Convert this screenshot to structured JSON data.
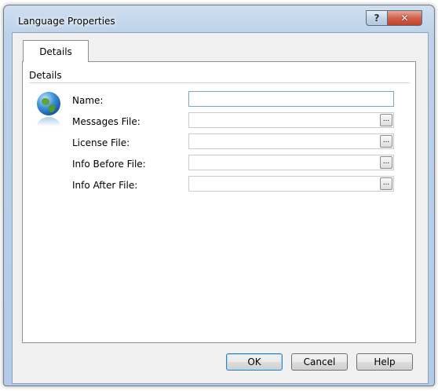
{
  "window": {
    "title": "Language Properties"
  },
  "titlebar": {
    "help_glyph": "?",
    "close_glyph": "✕"
  },
  "tabs": [
    {
      "label": "Details"
    }
  ],
  "group": {
    "label": "Details"
  },
  "fields": [
    {
      "label": "Name:",
      "value": "",
      "has_browse": false
    },
    {
      "label": "Messages File:",
      "value": "",
      "has_browse": true
    },
    {
      "label": "License File:",
      "value": "",
      "has_browse": true
    },
    {
      "label": "Info Before File:",
      "value": "",
      "has_browse": true
    },
    {
      "label": "Info After File:",
      "value": "",
      "has_browse": true
    }
  ],
  "browse_label": "...",
  "buttons": {
    "ok": "OK",
    "cancel": "Cancel",
    "help": "Help"
  },
  "icons": {
    "header": "globe-icon"
  },
  "colors": {
    "title_bar": "#b9cfe8",
    "close_button": "#c9472f",
    "default_button_border": "#3c7fb1"
  }
}
